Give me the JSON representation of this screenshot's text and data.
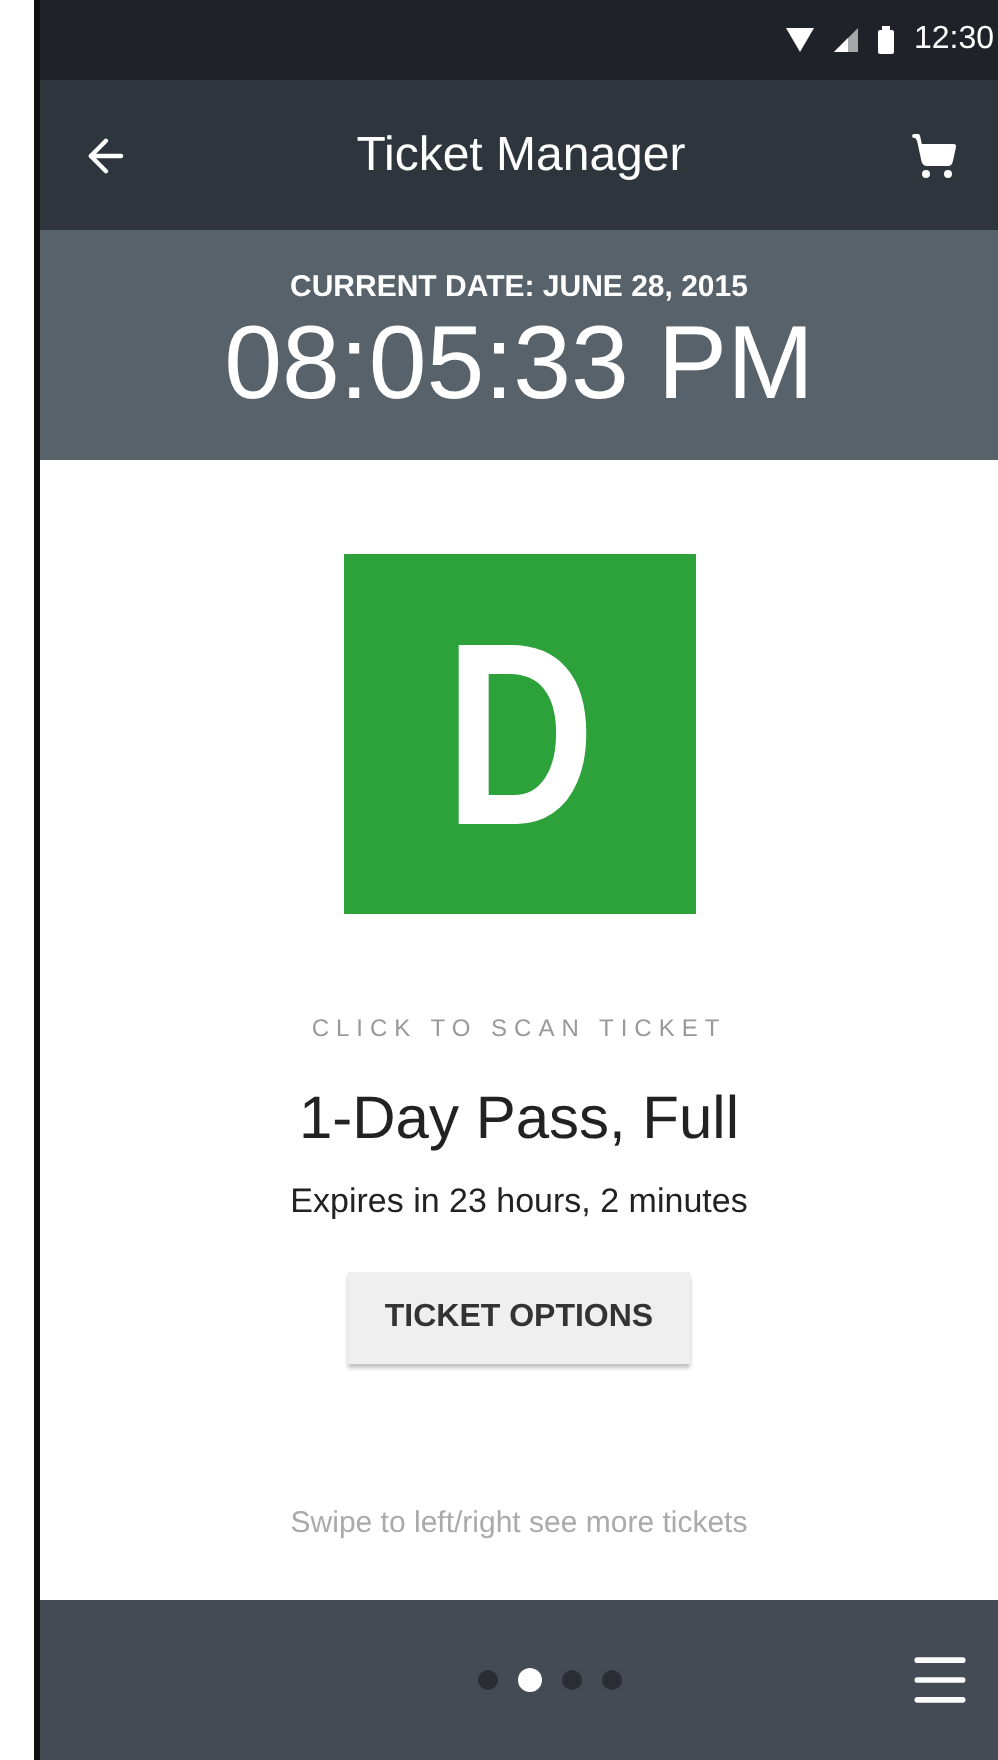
{
  "status_bar": {
    "time": "12:30"
  },
  "app_bar": {
    "title": "Ticket Manager"
  },
  "clock": {
    "date": "CURRENT DATE: JUNE 28, 2015",
    "time": "08:05:33 PM"
  },
  "ticket": {
    "letter": "D",
    "color": "#2ea23a",
    "scan_hint": "CLICK TO SCAN TICKET",
    "name": "1-Day Pass, Full",
    "expiry": "Expires in 23 hours, 2 minutes",
    "options_button": "TICKET OPTIONS"
  },
  "swipe_hint": "Swipe to left/right see more tickets",
  "pager": [
    {
      "selected": false
    },
    {
      "selected": true
    },
    {
      "selected": false
    },
    {
      "selected": false
    }
  ]
}
